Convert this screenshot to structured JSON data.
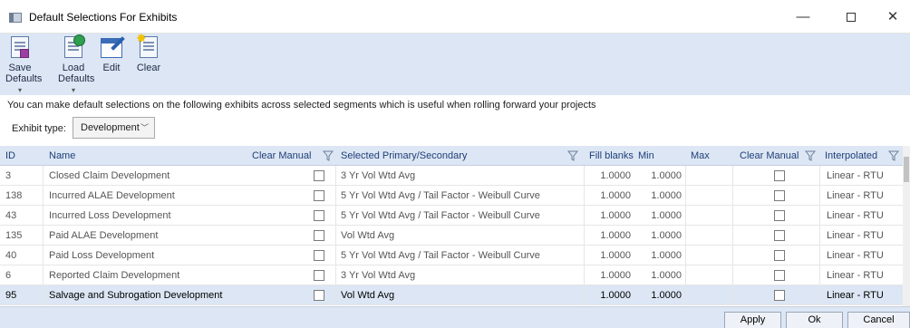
{
  "window": {
    "title": "Default Selections For Exhibits"
  },
  "toolbar": {
    "save": {
      "line1": "Save",
      "line2": "Defaults",
      "arrow": "▾"
    },
    "load": {
      "line1": "Load",
      "line2": "Defaults",
      "arrow": "▾"
    },
    "edit": "Edit",
    "clear": "Clear"
  },
  "info_text": "You can make default selections on the following exhibits across selected segments which is useful when rolling forward your projects",
  "exhibit_type": {
    "label": "Exhibit type:",
    "value": "Development"
  },
  "columns": {
    "id": "ID",
    "name": "Name",
    "clear_manual_1": "Clear Manual",
    "selected": "Selected Primary/Secondary",
    "fill_blanks": "Fill blanks",
    "min": "Min",
    "max": "Max",
    "clear_manual_2": "Clear Manual",
    "interpolated": "Interpolated"
  },
  "rows": [
    {
      "id": "3",
      "name": "Closed Claim Development",
      "selected": "3 Yr Vol Wtd Avg",
      "fill": "1.0000",
      "min": "1.0000",
      "max": "",
      "interp": "Linear - RTU"
    },
    {
      "id": "138",
      "name": "Incurred ALAE Development",
      "selected": "5 Yr Vol Wtd Avg / Tail Factor - Weibull Curve",
      "fill": "1.0000",
      "min": "1.0000",
      "max": "",
      "interp": "Linear - RTU"
    },
    {
      "id": "43",
      "name": "Incurred Loss Development",
      "selected": "5 Yr Vol Wtd Avg / Tail Factor - Weibull Curve",
      "fill": "1.0000",
      "min": "1.0000",
      "max": "",
      "interp": "Linear - RTU"
    },
    {
      "id": "135",
      "name": "Paid ALAE Development",
      "selected": "Vol Wtd Avg",
      "fill": "1.0000",
      "min": "1.0000",
      "max": "",
      "interp": "Linear - RTU"
    },
    {
      "id": "40",
      "name": "Paid Loss Development",
      "selected": "5 Yr Vol Wtd Avg / Tail Factor - Weibull Curve",
      "fill": "1.0000",
      "min": "1.0000",
      "max": "",
      "interp": "Linear - RTU"
    },
    {
      "id": "6",
      "name": "Reported Claim Development",
      "selected": "3 Yr Vol Wtd Avg",
      "fill": "1.0000",
      "min": "1.0000",
      "max": "",
      "interp": "Linear - RTU"
    },
    {
      "id": "95",
      "name": "Salvage and Subrogation Development",
      "selected": "Vol Wtd Avg",
      "fill": "1.0000",
      "min": "1.0000",
      "max": "",
      "interp": "Linear - RTU"
    }
  ],
  "buttons": {
    "apply": "Apply",
    "ok": "Ok",
    "cancel": "Cancel"
  },
  "colors": {
    "ribbon": "#dce6f4",
    "selected_row": "#dce6f4",
    "header_text": "#1f3f77"
  }
}
